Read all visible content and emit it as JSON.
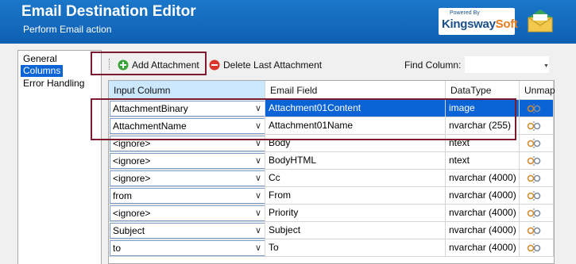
{
  "banner": {
    "title": "Email Destination Editor",
    "subtitle": "Perform Email action",
    "logo_powered": "Powered By",
    "logo_k": "K",
    "logo_ingsway": "ingsway",
    "logo_soft": "Soft"
  },
  "nav": {
    "items": [
      {
        "label": "General",
        "selected": false
      },
      {
        "label": "Columns",
        "selected": true
      },
      {
        "label": "Error Handling",
        "selected": false
      }
    ]
  },
  "toolbar": {
    "add_label": "Add Attachment",
    "delete_label": "Delete Last Attachment",
    "find_label": "Find Column:",
    "find_value": ""
  },
  "grid": {
    "headers": [
      "Input Column",
      "Email Field",
      "DataType",
      "Unmap"
    ],
    "rows": [
      {
        "input": "AttachmentBinary",
        "field": "Attachment01Content",
        "type": "image",
        "selected": true
      },
      {
        "input": "AttachmentName",
        "field": "Attachment01Name",
        "type": "nvarchar (255)",
        "selected": false
      },
      {
        "input": "<ignore>",
        "field": "Body",
        "type": "ntext",
        "selected": false
      },
      {
        "input": "<ignore>",
        "field": "BodyHTML",
        "type": "ntext",
        "selected": false
      },
      {
        "input": "<ignore>",
        "field": "Cc",
        "type": "nvarchar (4000)",
        "selected": false
      },
      {
        "input": "from",
        "field": "From",
        "type": "nvarchar (4000)",
        "selected": false
      },
      {
        "input": "<ignore>",
        "field": "Priority",
        "type": "nvarchar (4000)",
        "selected": false
      },
      {
        "input": "Subject",
        "field": "Subject",
        "type": "nvarchar (4000)",
        "selected": false
      },
      {
        "input": "to",
        "field": "To",
        "type": "nvarchar (4000)",
        "selected": false
      }
    ]
  },
  "colors": {
    "banner_blue": "#0e5fb2",
    "selection_blue": "#0a64d6",
    "highlight_border": "#7b1b2f",
    "add_icon_green": "#3aa33a",
    "delete_icon_red": "#d9362b"
  },
  "icons": {
    "add": "plus-circle-icon",
    "delete": "minus-circle-icon",
    "unmap": "unlink-icon",
    "envelope": "envelope-icon"
  }
}
